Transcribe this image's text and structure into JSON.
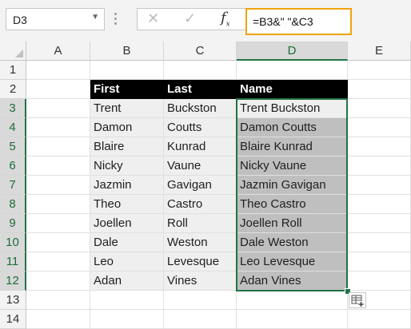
{
  "name_box": {
    "value": "D3"
  },
  "formula_bar": {
    "cancel_icon": "close-icon",
    "confirm_icon": "check-icon",
    "function_icon": "fx-icon",
    "fx_label": "fx",
    "formula": "=B3&\" \"&C3"
  },
  "columns": [
    "A",
    "B",
    "C",
    "D",
    "E"
  ],
  "rows": [
    "1",
    "2",
    "3",
    "4",
    "5",
    "6",
    "7",
    "8",
    "9",
    "10",
    "11",
    "12",
    "13",
    "14"
  ],
  "table": {
    "headers": [
      "First",
      "Last",
      "Name"
    ],
    "data": [
      [
        "Trent",
        "Buckston",
        "Trent Buckston"
      ],
      [
        "Damon",
        "Coutts",
        "Damon Coutts"
      ],
      [
        "Blaire",
        "Kunrad",
        "Blaire Kunrad"
      ],
      [
        "Nicky",
        "Vaune",
        "Nicky Vaune"
      ],
      [
        "Jazmin",
        "Gavigan",
        "Jazmin Gavigan"
      ],
      [
        "Theo",
        "Castro",
        "Theo Castro"
      ],
      [
        "Joellen",
        "Roll",
        "Joellen Roll"
      ],
      [
        "Dale",
        "Weston",
        "Dale Weston"
      ],
      [
        "Leo",
        "Levesque",
        "Leo Levesque"
      ],
      [
        "Adan",
        "Vines",
        "Adan Vines"
      ]
    ]
  },
  "selection": {
    "range": "D3:D12",
    "active_cell": "D3"
  },
  "colors": {
    "selection": "#217346",
    "formula_highlight": "#f0a30a",
    "header_fill": "#000000"
  },
  "quick_analysis_icon": "quick-analysis-icon"
}
